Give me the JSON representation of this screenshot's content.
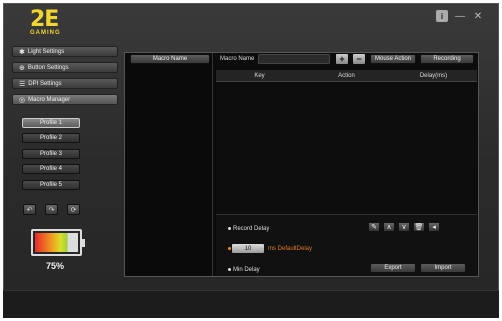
{
  "logo": {
    "big": "2E",
    "small": "GAMING"
  },
  "window_controls": {
    "info": "i",
    "minimize": "—",
    "close": "✕"
  },
  "nav": [
    {
      "label": "Light Settings",
      "icon": "✱"
    },
    {
      "label": "Button Settings",
      "icon": "⊕"
    },
    {
      "label": "DPI Settings",
      "icon": "☰"
    },
    {
      "label": "Macro Manager",
      "icon": "◎"
    }
  ],
  "profiles": [
    "Profile 1",
    "Profile 2",
    "Profile 3",
    "Profile 4",
    "Profile 5"
  ],
  "profile_tools": [
    "↶",
    "↷",
    "⟳"
  ],
  "battery": {
    "percent_label": "75%",
    "level": 0.75
  },
  "macro": {
    "list_header": "Macro Name",
    "name_label": "Macro Name",
    "plus": "+",
    "minus": "−",
    "mouse_action": "Mouse Action",
    "recording": "Recording",
    "columns": [
      "Key",
      "Action",
      "Delay(ms)"
    ],
    "record_delay": "Record Delay",
    "delay_value": "10",
    "delay_unit": "ms DefaultDelay",
    "min_delay": "Min Delay",
    "export": "Export",
    "import": "Import",
    "tools": [
      "✎",
      "∧",
      "∨",
      "🗑",
      "◂"
    ]
  }
}
